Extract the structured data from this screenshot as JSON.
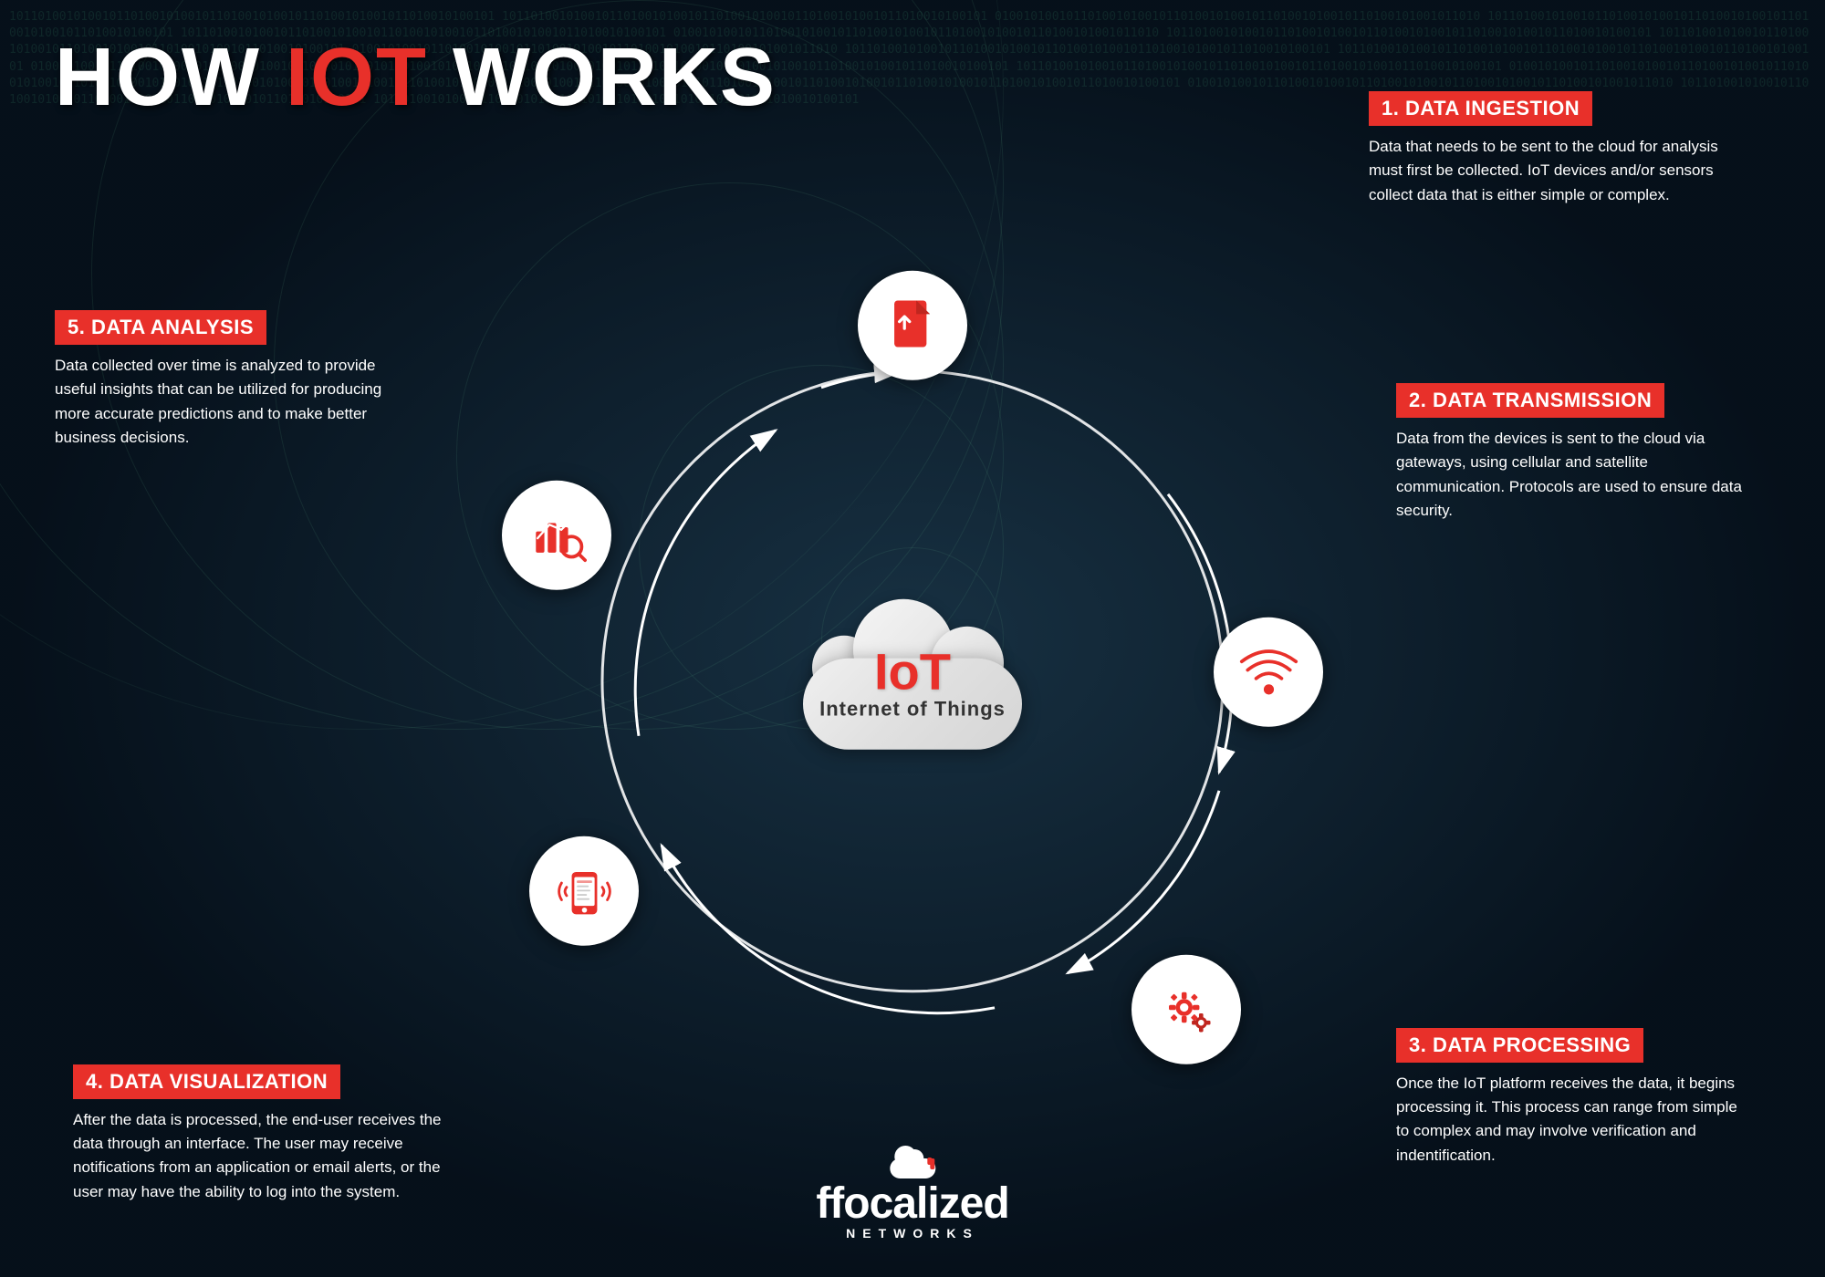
{
  "title": {
    "prefix": "HOW ",
    "highlight": "IoT",
    "suffix": " WORKS"
  },
  "center": {
    "iot_label": "IoT",
    "subtitle": "Internet of Things"
  },
  "steps": [
    {
      "id": 1,
      "label": "1. DATA INGESTION",
      "description": "Data that needs to be sent to the cloud for analysis must first be collected. IoT devices and/or sensors collect data that is either simple or complex."
    },
    {
      "id": 2,
      "label": "2. DATA TRANSMISSION",
      "description": "Data from the devices is sent to the cloud via gateways, using cellular and satellite communication. Protocols are used to ensure data security."
    },
    {
      "id": 3,
      "label": "3. DATA PROCESSING",
      "description": "Once the IoT platform receives the data, it begins processing it. This process can range from simple to complex and may involve verification and indentification."
    },
    {
      "id": 4,
      "label": "4. DATA VISUALIZATION",
      "description": "After the data is processed, the end-user receives the data through an interface. The user may receive notifications from an application or email alerts, or the user may have the ability to log into the system."
    },
    {
      "id": 5,
      "label": "5. DATA ANALYSIS",
      "description": "Data collected over time is analyzed to provide useful insights that can be utilized for producing more accurate predictions and to make better business decisions."
    }
  ],
  "logo": {
    "name": "focalized",
    "sub": "NETWORKS"
  }
}
